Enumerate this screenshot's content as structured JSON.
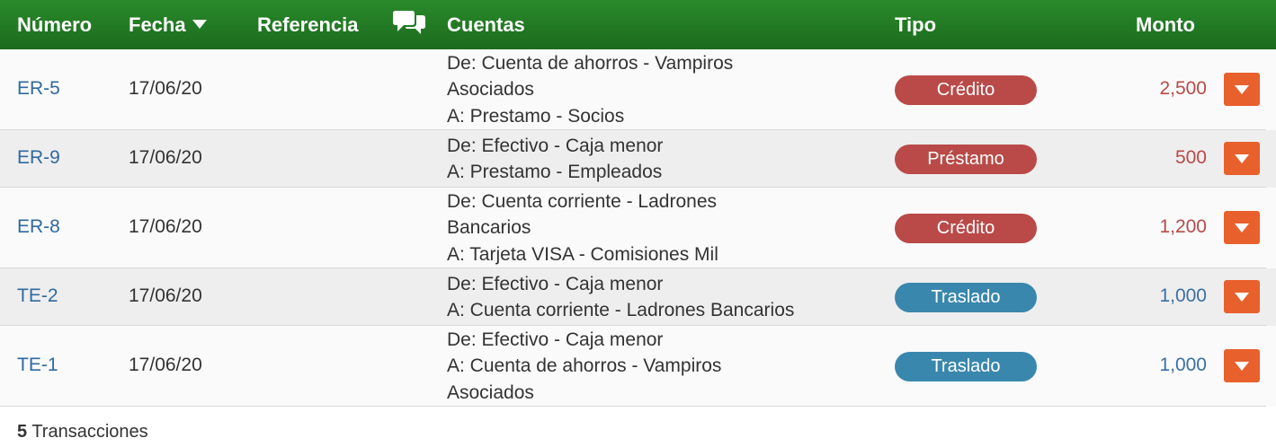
{
  "header": {
    "numero": "Número",
    "fecha": "Fecha",
    "referencia": "Referencia",
    "cuentas": "Cuentas",
    "tipo": "Tipo",
    "monto": "Monto",
    "comment_icon": "comments-icon",
    "sort_icon": "caret-down-icon"
  },
  "colors": {
    "header_green": "#1c6b1e",
    "link_blue": "#2f6aa0",
    "credit_red": "#b94a48",
    "transfer_blue": "#3a87ad",
    "action_orange": "#e8602c"
  },
  "rows": [
    {
      "number": "ER-5",
      "date": "17/06/20",
      "reference": "",
      "accounts": [
        "De: Cuenta de ahorros - Vampiros",
        "Asociados",
        "A: Prestamo - Socios"
      ],
      "type": "Crédito",
      "type_color": "#b94a48",
      "amount": "2,500",
      "amount_color": "#b94a48"
    },
    {
      "number": "ER-9",
      "date": "17/06/20",
      "reference": "",
      "accounts": [
        "De: Efectivo - Caja menor",
        "A: Prestamo - Empleados"
      ],
      "type": "Préstamo",
      "type_color": "#b94a48",
      "amount": "500",
      "amount_color": "#b94a48"
    },
    {
      "number": "ER-8",
      "date": "17/06/20",
      "reference": "",
      "accounts": [
        "De: Cuenta corriente - Ladrones",
        "Bancarios",
        "A: Tarjeta VISA - Comisiones Mil"
      ],
      "type": "Crédito",
      "type_color": "#b94a48",
      "amount": "1,200",
      "amount_color": "#b94a48"
    },
    {
      "number": "TE-2",
      "date": "17/06/20",
      "reference": "",
      "accounts": [
        "De: Efectivo - Caja menor",
        "A: Cuenta corriente - Ladrones Bancarios"
      ],
      "type": "Traslado",
      "type_color": "#3a87ad",
      "amount": "1,000",
      "amount_color": "#3a6fa5"
    },
    {
      "number": "TE-1",
      "date": "17/06/20",
      "reference": "",
      "accounts": [
        "De: Efectivo - Caja menor",
        "A: Cuenta de ahorros - Vampiros",
        "Asociados"
      ],
      "type": "Traslado",
      "type_color": "#3a87ad",
      "amount": "1,000",
      "amount_color": "#3a6fa5"
    }
  ],
  "footer": {
    "count": "5",
    "label": " Transacciones"
  }
}
